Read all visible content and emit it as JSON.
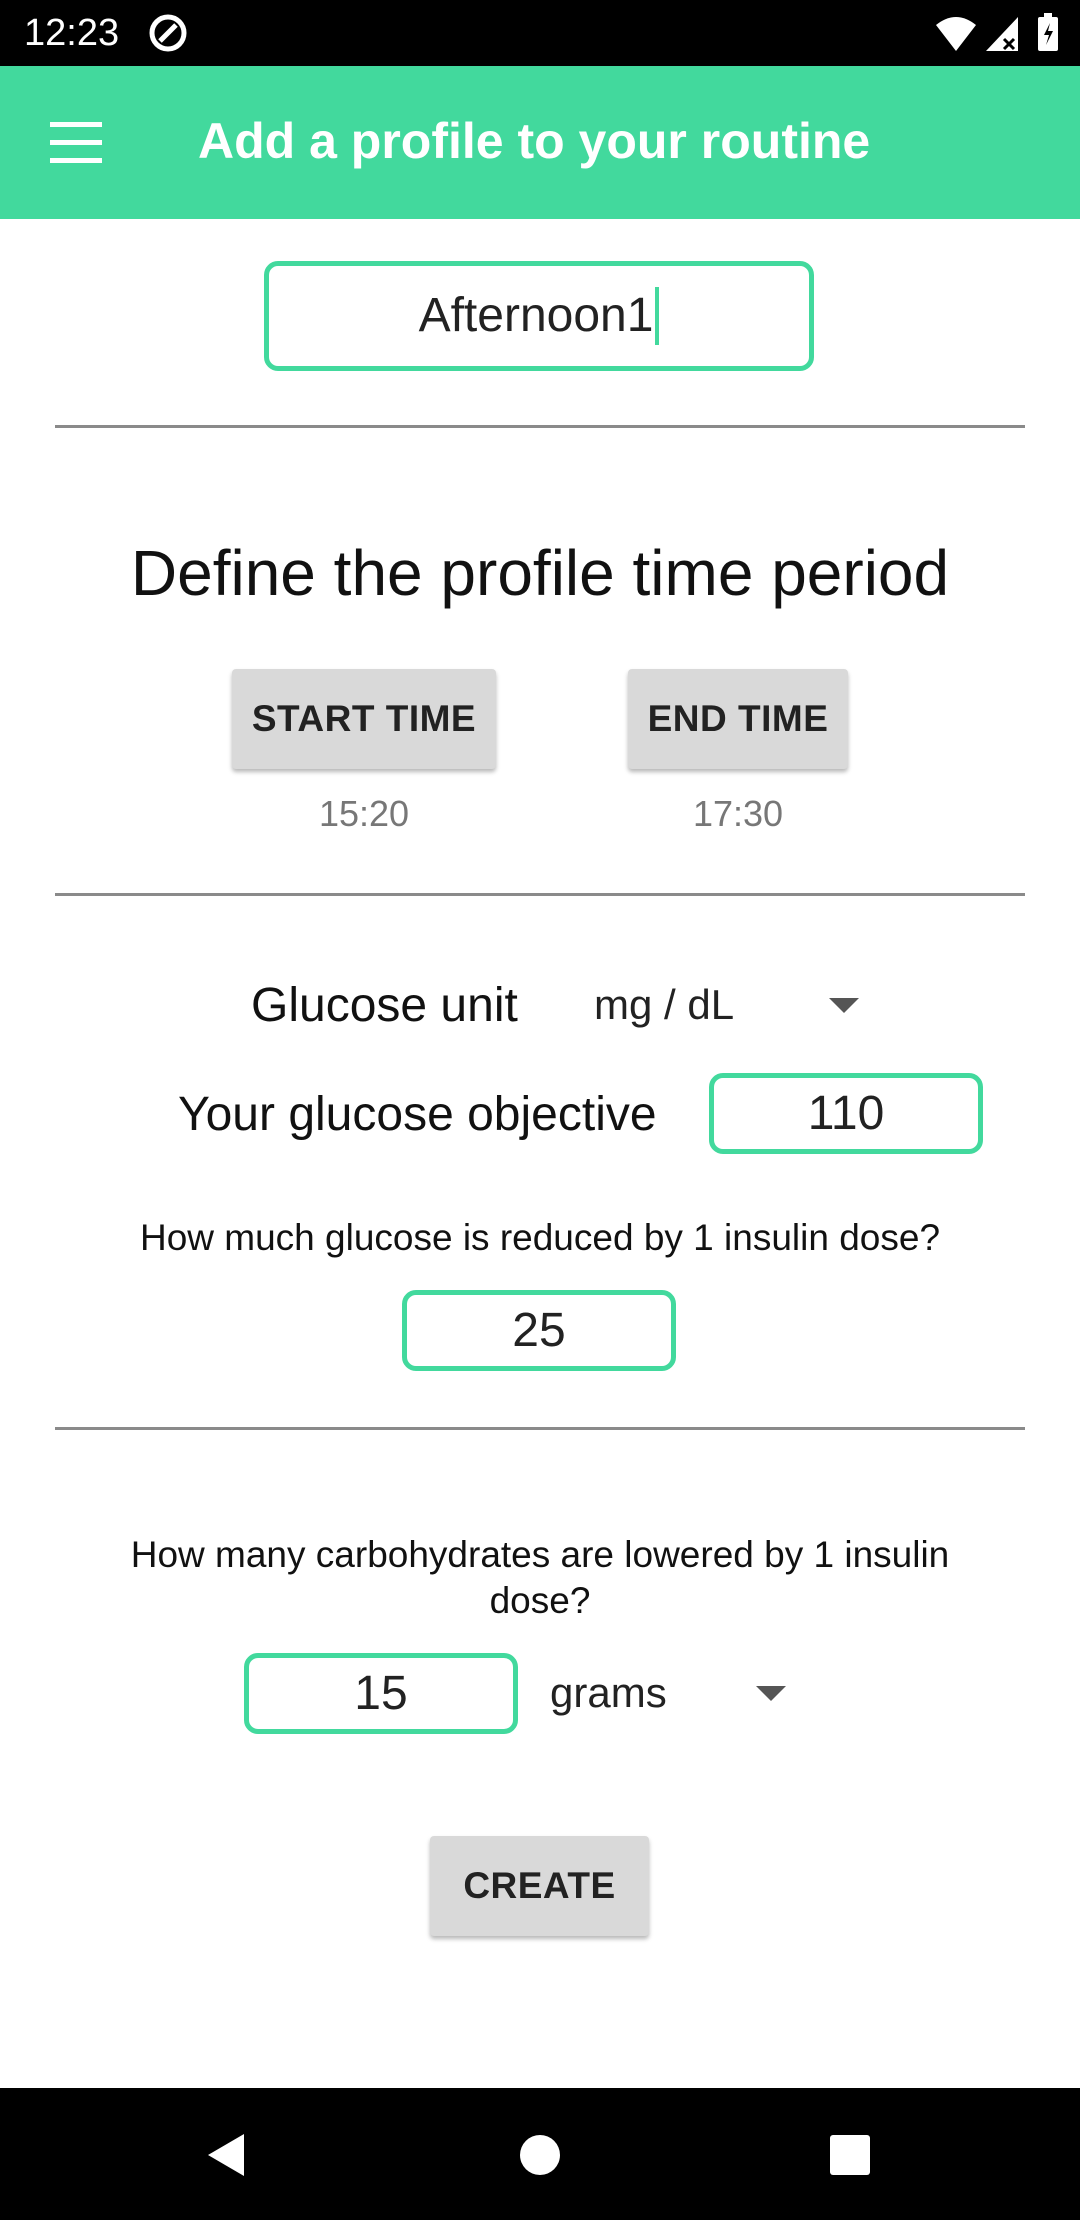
{
  "status_bar": {
    "time": "12:23",
    "icons": [
      "at-sign-icon",
      "wifi-icon",
      "signal-icon",
      "battery-icon"
    ]
  },
  "app_bar": {
    "title": "Add a profile to your routine",
    "menu_icon": "hamburger-menu-icon",
    "color": "#42d99d"
  },
  "profile": {
    "name_value": "Afternoon1"
  },
  "time_period": {
    "heading": "Define the profile time period",
    "start_button": "START TIME",
    "start_value": "15:20",
    "end_button": "END TIME",
    "end_value": "17:30"
  },
  "glucose": {
    "unit_label": "Glucose unit",
    "unit_selected": "mg / dL",
    "objective_label": "Your glucose objective",
    "objective_value": "110",
    "reduction_question": "How much glucose is reduced by 1 insulin dose?",
    "reduction_value": "25"
  },
  "carbs": {
    "question": "How many carbohydrates are lowered by 1 insulin dose?",
    "value": "15",
    "unit_selected": "grams"
  },
  "actions": {
    "create_button": "CREATE"
  },
  "nav_bar": {
    "icons": [
      "back-icon",
      "home-icon",
      "recents-icon"
    ]
  }
}
